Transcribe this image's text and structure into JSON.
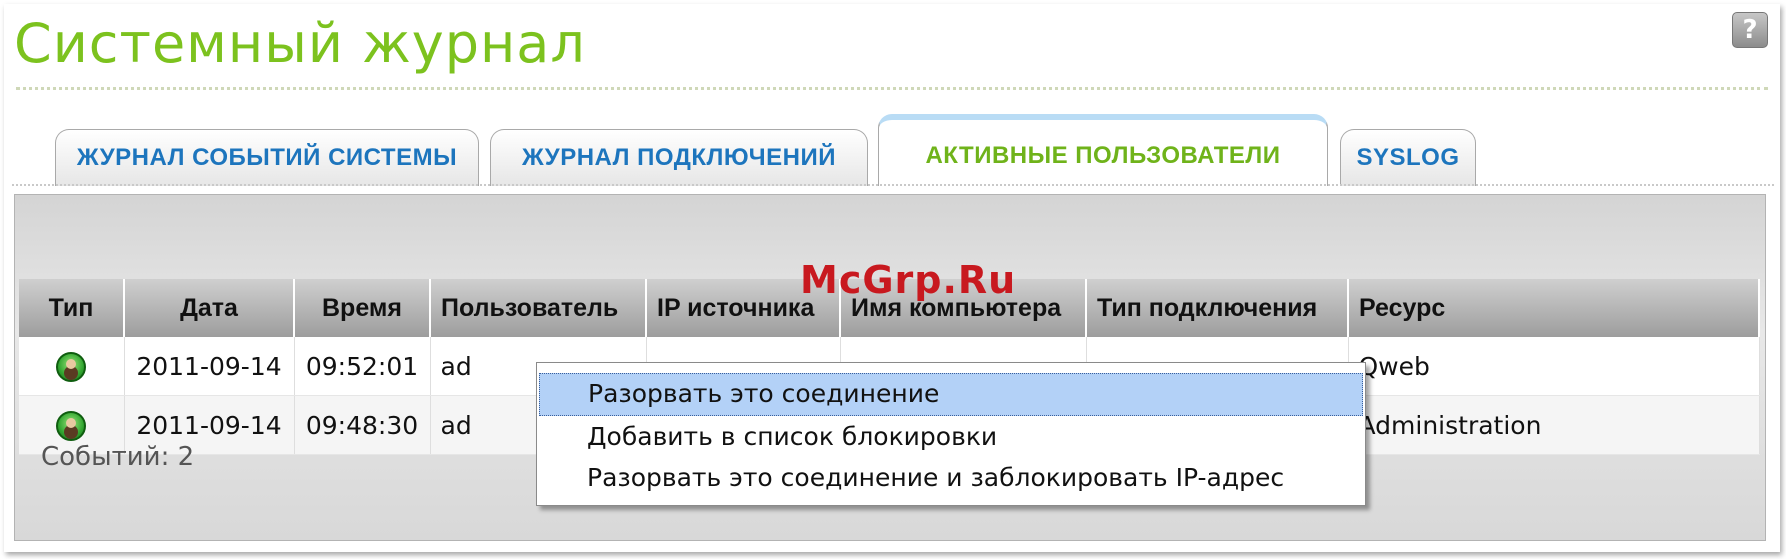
{
  "page": {
    "title": "Системный журнал",
    "help_glyph": "?"
  },
  "tabs": [
    {
      "label": "ЖУРНАЛ СОБЫТИЙ СИСТЕМЫ",
      "active": false
    },
    {
      "label": "ЖУРНАЛ ПОДКЛЮЧЕНИЙ",
      "active": false
    },
    {
      "label": "АКТИВНЫЕ ПОЛЬЗОВАТЕЛИ",
      "active": true
    },
    {
      "label": "SYSLOG",
      "active": false
    }
  ],
  "table": {
    "columns": [
      "Тип",
      "Дата",
      "Время",
      "Пользователь",
      "IP источника",
      "Имя компьютера",
      "Тип подключения",
      "Ресурс"
    ],
    "rows": [
      {
        "type_icon": "user-icon",
        "date": "2011-09-14",
        "time": "09:52:01",
        "user": "ad",
        "ip": "",
        "computer": "",
        "conn_type": "",
        "resource": "Qweb"
      },
      {
        "type_icon": "user-icon",
        "date": "2011-09-14",
        "time": "09:48:30",
        "user": "ad",
        "ip": "",
        "computer": "",
        "conn_type": "",
        "resource": "Administration"
      }
    ]
  },
  "footer": {
    "events_count": "Событий: 2"
  },
  "context_menu": {
    "items": [
      {
        "label": "Разорвать это соединение",
        "highlighted": true
      },
      {
        "label": "Добавить в список блокировки",
        "highlighted": false
      },
      {
        "label": "Разорвать это соединение и заблокировать IP-адрес",
        "highlighted": false
      }
    ]
  },
  "watermark": "McGrp.Ru",
  "colors": {
    "title": "#7cc21e",
    "tab_text": "#1d75bd",
    "active_tab_text": "#6fb31a",
    "menu_highlight": "#b3d1f7"
  }
}
